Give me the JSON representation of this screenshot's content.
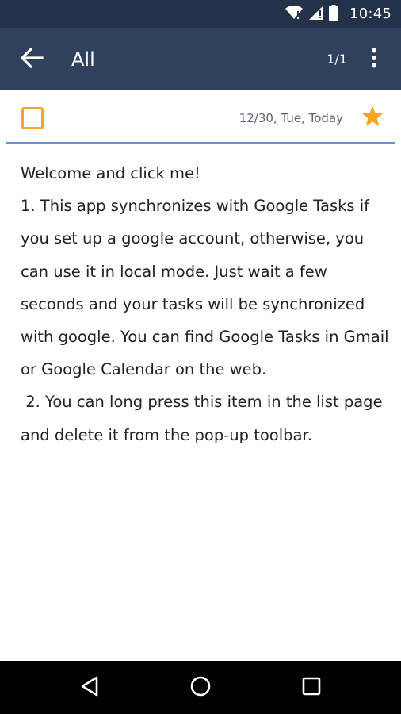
{
  "status_bar": {
    "time": "10:45",
    "icons": [
      "wifi-icon",
      "cellular-signal-icon",
      "battery-icon"
    ]
  },
  "app_bar": {
    "back_icon": "arrow-left-icon",
    "title": "All",
    "page_counter": "1/1",
    "overflow_icon": "more-vert-icon"
  },
  "task": {
    "checked": false,
    "date": "12/30, Tue, Today",
    "starred": true,
    "body": [
      "Welcome and click me!",
      "1. This app synchronizes with Google Tasks if you set up a google account, otherwise, you can use it in local mode. Just wait a few seconds and your tasks will be synchronized with google. You can find Google Tasks in Gmail or Google Calendar on the web.",
      " 2. You can long press this item in the list page and delete it from the pop-up toolbar."
    ]
  },
  "nav_bar": {
    "back_icon": "nav-back-icon",
    "home_icon": "nav-home-icon",
    "recents_icon": "nav-recents-icon"
  },
  "colors": {
    "status_bar_bg": "#243249",
    "app_bar_bg": "#2f415d",
    "accent_orange": "#f6a623",
    "divider_blue": "#6b8fd1",
    "nav_bar_bg": "#000000"
  }
}
